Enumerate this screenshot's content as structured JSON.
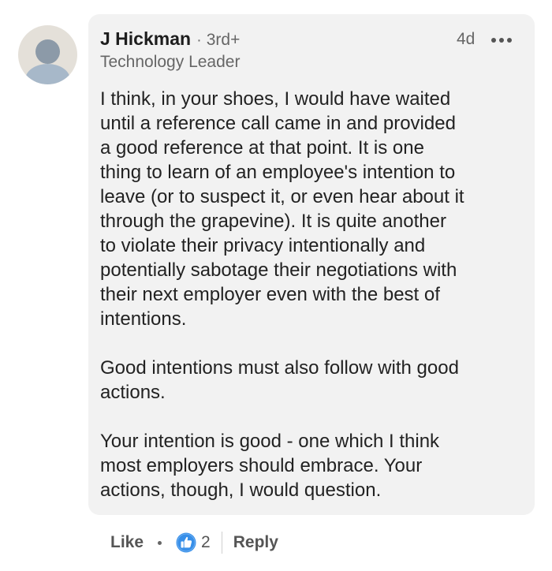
{
  "comment": {
    "author": "J Hickman",
    "separator": "·",
    "degree": "3rd+",
    "headline": "Technology Leader",
    "time": "4d",
    "body_lines": [
      "I think, in your shoes, I would have waited",
      "until a reference call came in and provided",
      "a good reference at that point.  It is one",
      "thing to learn of an employee's intention to",
      "leave (or to suspect it, or even hear about it",
      "through the grapevine).  It is quite another",
      "to violate their privacy intentionally and",
      "potentially sabotage their negotiations with",
      "their next employer even with the best of",
      "intentions.",
      "",
      "Good intentions must also follow with good",
      "actions.",
      "",
      "Your intention is good - one which I think",
      "most employers should embrace.  Your",
      "actions, though, I would question."
    ]
  },
  "actions": {
    "like_label": "Like",
    "reaction_count": "2",
    "reply_label": "Reply"
  },
  "colors": {
    "bubble_bg": "#f2f2f2",
    "like_blue": "#378fe9"
  },
  "icons": {
    "avatar": "default-person-avatar",
    "more": "ellipsis-horizontal-icon",
    "reaction": "thumbs-up-like-icon"
  }
}
